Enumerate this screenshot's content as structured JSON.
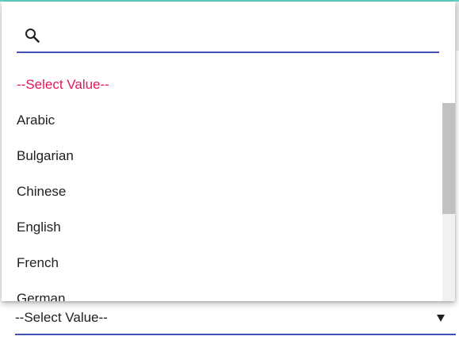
{
  "dropdown": {
    "search": {
      "placeholder": "",
      "value": "",
      "icon": "search-icon"
    },
    "items": [
      {
        "label": "--Select Value--",
        "is_placeholder": true
      },
      {
        "label": "Arabic"
      },
      {
        "label": "Bulgarian"
      },
      {
        "label": "Chinese"
      },
      {
        "label": "English"
      },
      {
        "label": "French"
      },
      {
        "label": "German"
      }
    ]
  },
  "select": {
    "value": "--Select Value--",
    "icon": "caret-down-icon"
  },
  "colors": {
    "accent": "#3f51b5",
    "placeholder": "#e3165b",
    "top_accent": "#5fd3c6"
  }
}
